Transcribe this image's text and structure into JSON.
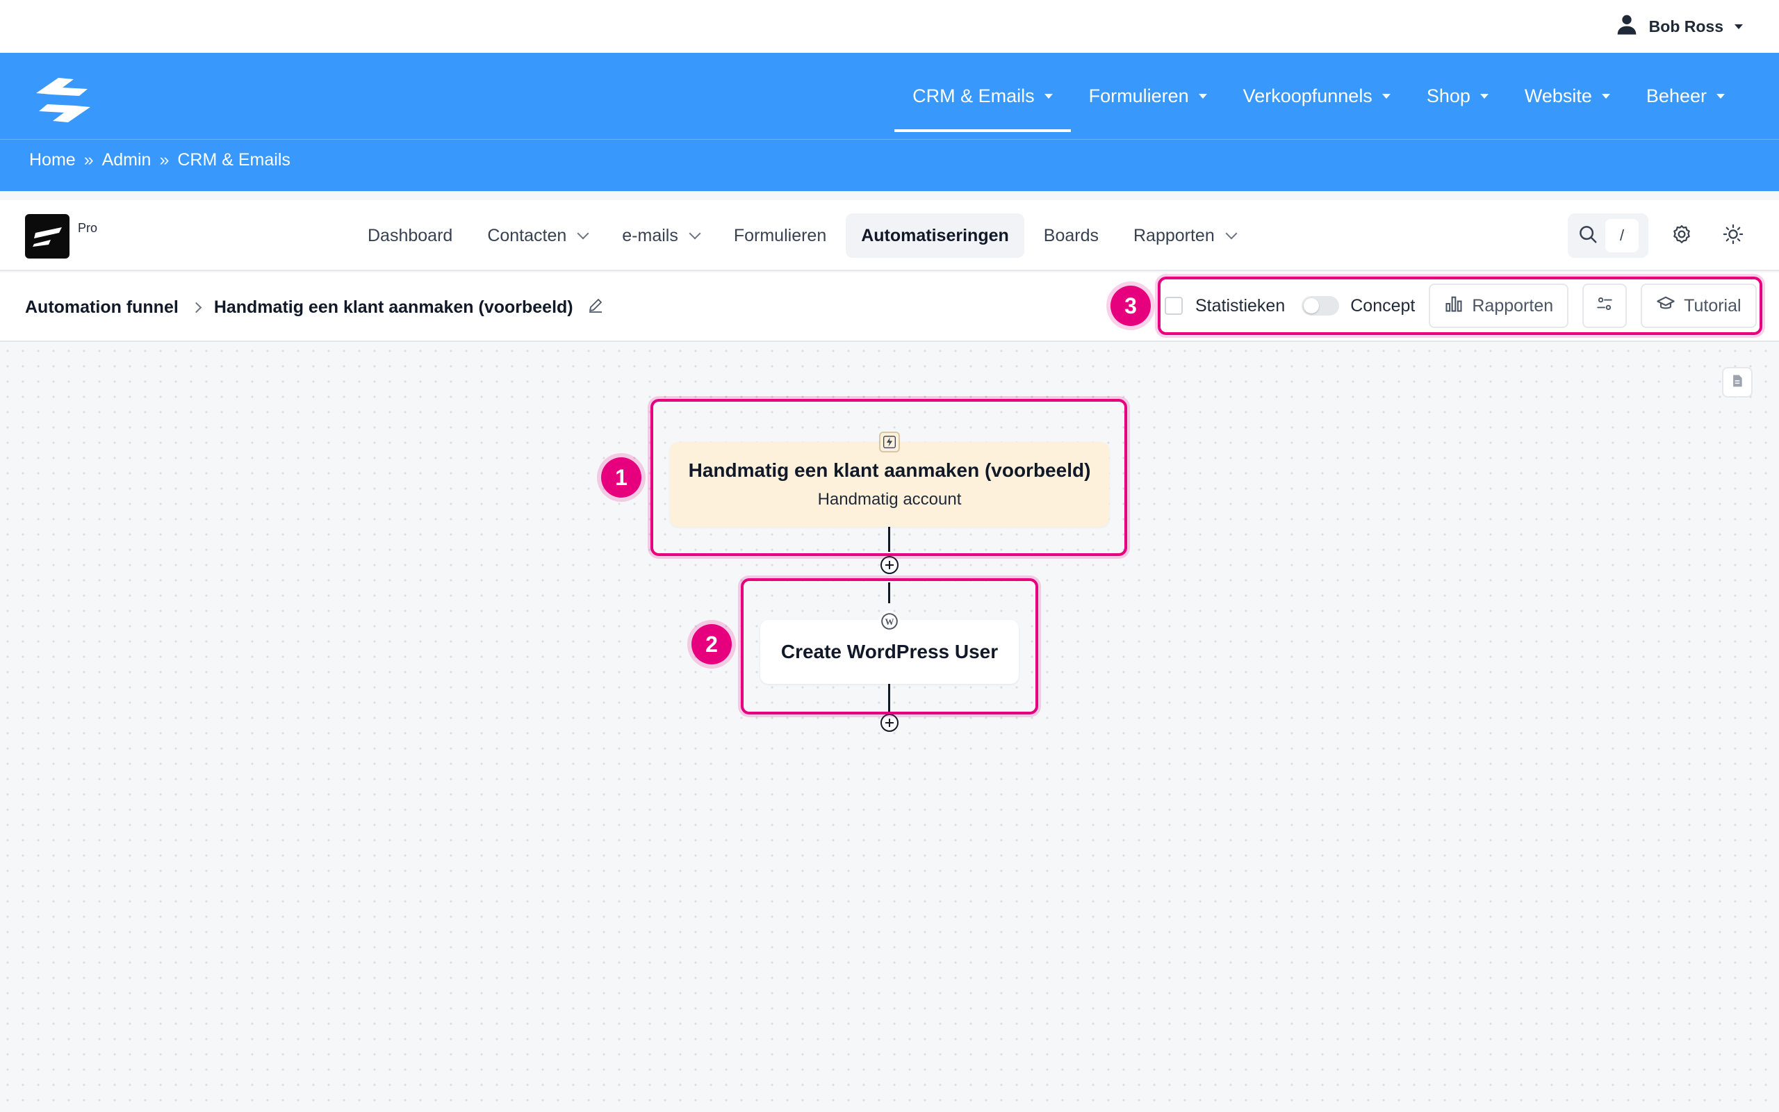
{
  "user": {
    "name": "Bob Ross",
    "icon": "user-icon"
  },
  "main_nav": [
    {
      "label": "CRM & Emails",
      "active": true
    },
    {
      "label": "Formulieren"
    },
    {
      "label": "Verkoopfunnels"
    },
    {
      "label": "Shop"
    },
    {
      "label": "Website"
    },
    {
      "label": "Beheer"
    }
  ],
  "breadcrumb": {
    "items": [
      "Home",
      "Admin",
      "CRM & Emails"
    ],
    "separator": "»"
  },
  "app": {
    "badge": "Pro",
    "tabs": [
      {
        "label": "Dashboard"
      },
      {
        "label": "Contacten",
        "dropdown": true
      },
      {
        "label": "e-mails",
        "dropdown": true
      },
      {
        "label": "Formulieren"
      },
      {
        "label": "Automatiseringen",
        "active": true
      },
      {
        "label": "Boards"
      },
      {
        "label": "Rapporten",
        "dropdown": true
      }
    ],
    "search_shortcut": "/"
  },
  "funnel": {
    "parent": "Automation funnel",
    "name": "Handmatig een klant aanmaken (voorbeeld)"
  },
  "actions": {
    "stats_label": "Statistieken",
    "stats_checked": false,
    "concept_label": "Concept",
    "concept_on": false,
    "reports_label": "Rapporten",
    "tutorial_label": "Tutorial"
  },
  "nodes": {
    "trigger": {
      "title": "Handmatig een klant aanmaken (voorbeeld)",
      "subtitle": "Handmatig account",
      "icon": "lightning-icon"
    },
    "action": {
      "title": "Create WordPress User",
      "icon": "wordpress-icon"
    }
  },
  "annotations": [
    "1",
    "2",
    "3"
  ],
  "colors": {
    "header": "#3898fb",
    "highlight": "#e6007e",
    "trigger_bg": "#fdf1dc"
  }
}
